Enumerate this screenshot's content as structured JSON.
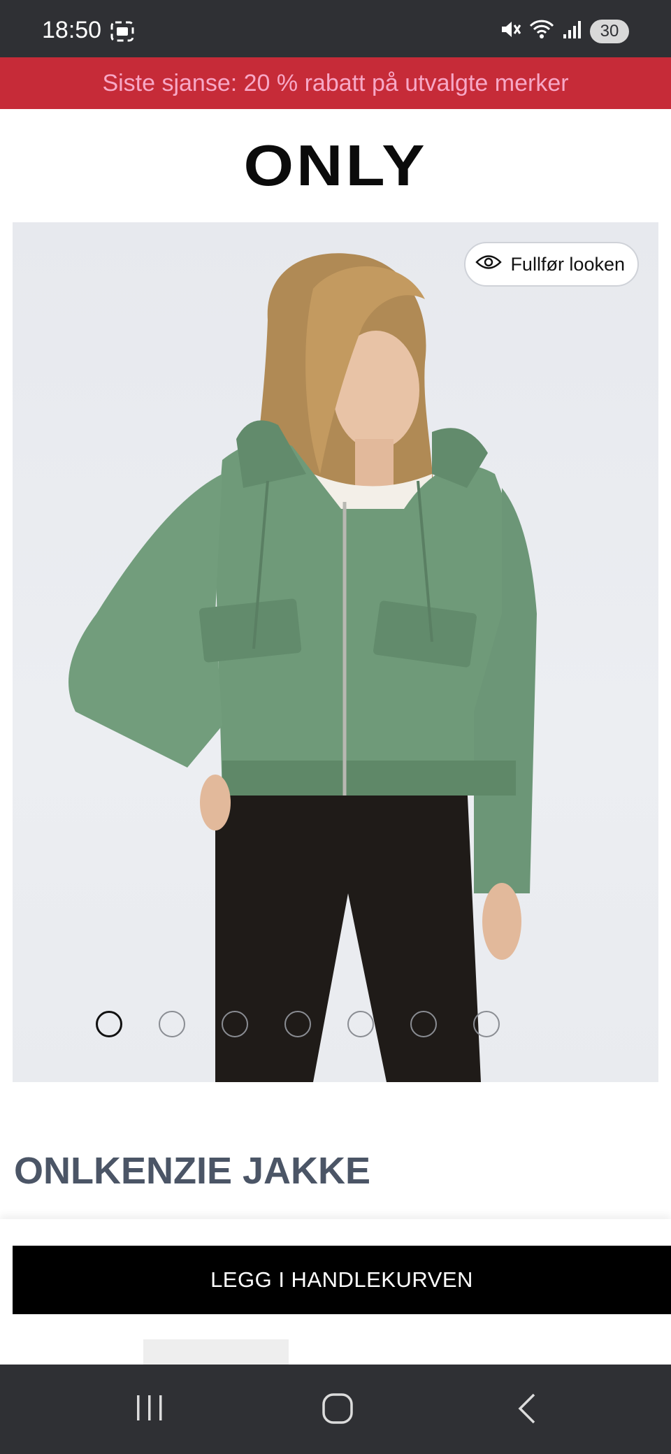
{
  "status_bar": {
    "time": "18:50",
    "battery": "30",
    "icons": [
      "screenshot-icon",
      "mute-icon",
      "wifi-icon",
      "signal-icon"
    ]
  },
  "promo": {
    "text": "Siste sjanse: 20 % rabatt på utvalgte merker"
  },
  "brand": {
    "logo": "ONLY"
  },
  "gallery": {
    "complete_look_label": "Fullfør looken",
    "dot_count": 7,
    "active_index": 0
  },
  "product": {
    "title": "ONLKENZIE JAKKE",
    "add_to_cart_label": "LEGG I HANDLEKURVEN"
  },
  "colors": {
    "promo_bg": "#c62b38",
    "promo_text": "#f7a8c6",
    "title": "#4b5566",
    "jacket": "#6f9a79"
  }
}
